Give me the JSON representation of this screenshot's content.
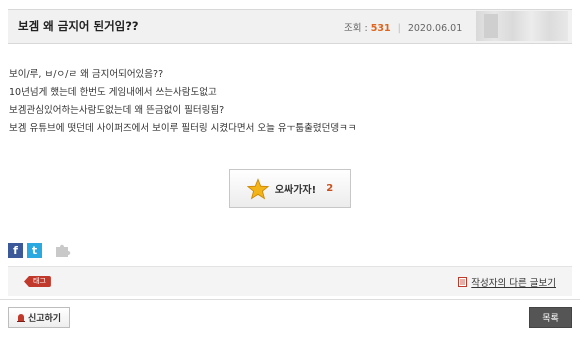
{
  "post": {
    "title": "보겜 왜 금지어 된거임??",
    "views_label": "조회 :",
    "views_count": "531",
    "date": "2020.06.01"
  },
  "body_lines": [
    "보이/루, ㅂ/ㅇ/ㄹ 왜 금지어되어있음??",
    "10년넘게 했는데 한번도 게임내에서 쓰는사람도없고",
    "보겜관심있어하는사람도없는데 왜 뜬금없이 필터링됨?",
    "보겜 유튜브에 떳던데 사이퍼즈에서 보이루 필터링 시켰다면서 오늘 유ㅜ툽출렸던뎅ㅋㅋ"
  ],
  "recommend": {
    "label": "오싸가자!",
    "count": "2"
  },
  "share": {
    "facebook": "f",
    "twitter": "t"
  },
  "tags": {
    "badge": "태그"
  },
  "author_posts_link": "작성자의 다른 글보기",
  "buttons": {
    "report": "신고하기",
    "list": "목록"
  },
  "colors": {
    "views": "#e0641c",
    "recommend_count": "#c8501a",
    "facebook": "#3b5998",
    "twitter": "#2aa9e0",
    "tag_badge": "#c0392b",
    "list_button": "#555555"
  },
  "icons": [
    "star-icon",
    "facebook-icon",
    "twitter-icon",
    "puzzle-icon",
    "document-icon",
    "siren-icon"
  ]
}
